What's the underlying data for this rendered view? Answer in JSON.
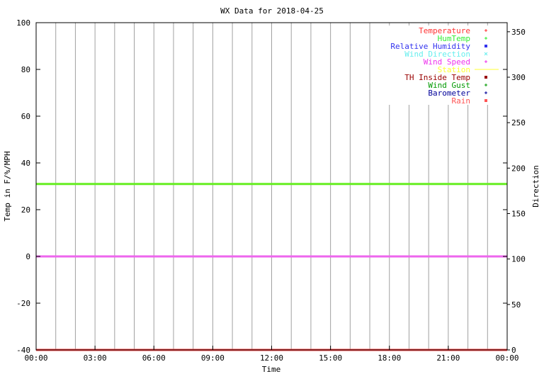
{
  "chart_data": {
    "type": "line",
    "title": "WX Data for 2018-04-25",
    "xlabel": "Time",
    "ylabel": "Temp in F/%/MPH",
    "y2label": "Direction",
    "x_ticks": [
      "00:00",
      "03:00",
      "06:00",
      "09:00",
      "12:00",
      "15:00",
      "18:00",
      "21:00",
      "00:00"
    ],
    "ylim": [
      -40,
      100
    ],
    "yticks": [
      -40,
      -20,
      0,
      20,
      40,
      60,
      80,
      100
    ],
    "y2lim": [
      0,
      360
    ],
    "y2ticks": [
      0,
      50,
      100,
      150,
      200,
      250,
      300,
      350
    ],
    "grid": "vertical",
    "legend_position": "top-right",
    "legend": [
      {
        "name": "Temperature",
        "color": "#ff3333",
        "marker": "+"
      },
      {
        "name": "HumTemp",
        "color": "#33ee33",
        "marker": "+"
      },
      {
        "name": "Relative Humidity",
        "color": "#3333ee",
        "marker": "square"
      },
      {
        "name": "Wind Direction",
        "color": "#66eeee",
        "marker": "x"
      },
      {
        "name": "Wind Speed",
        "color": "#ee33ee",
        "marker": "+"
      },
      {
        "name": "Station",
        "color": "#ffff33",
        "marker": "line"
      },
      {
        "name": "TH Inside Temp",
        "color": "#990000",
        "marker": "square"
      },
      {
        "name": "Wind Gust",
        "color": "#009900",
        "marker": "+"
      },
      {
        "name": "Barometer",
        "color": "#000099",
        "marker": "+"
      },
      {
        "name": "Rain",
        "color": "#ff5555",
        "marker": "square"
      }
    ],
    "series": [
      {
        "name": "HumTemp",
        "color": "#66ee22",
        "y": 31,
        "x_range": [
          "00:00",
          "00:00"
        ]
      },
      {
        "name": "Wind Speed",
        "color": "#ee66ee",
        "y": 0,
        "x_range": [
          "00:00",
          "00:00"
        ]
      },
      {
        "name": "Rain",
        "color": "#ff4444",
        "y": -40,
        "x_range": [
          "00:00",
          "00:00"
        ]
      }
    ]
  }
}
